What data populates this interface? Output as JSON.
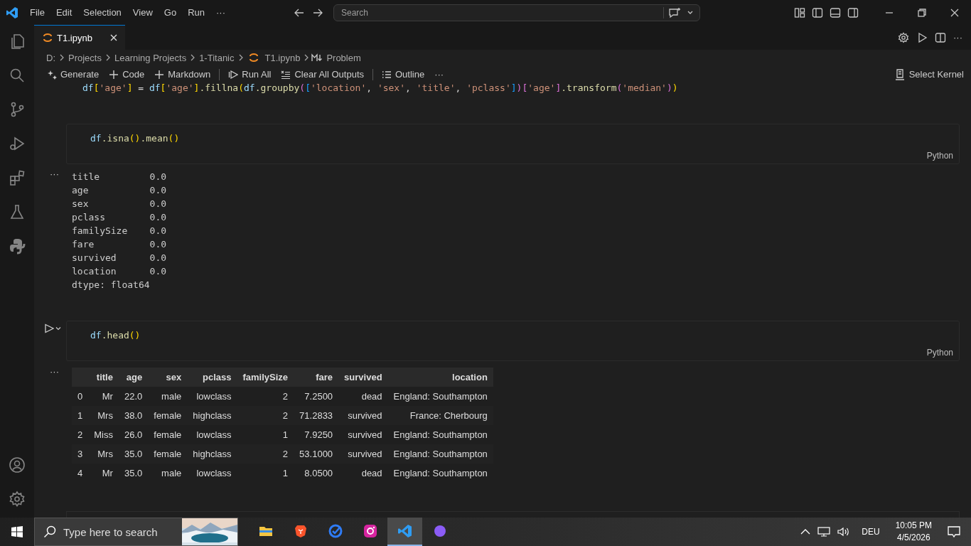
{
  "menu": [
    "File",
    "Edit",
    "Selection",
    "View",
    "Go",
    "Run",
    "···"
  ],
  "search": {
    "placeholder": "Search"
  },
  "tabs": [
    {
      "label": "T1.ipynb",
      "selected": true
    }
  ],
  "editor_actions_more": "···",
  "breadcrumb": [
    "D:",
    "Projects",
    "Learning Projects",
    "1-Titanic",
    "T1.ipynb",
    "Problem"
  ],
  "toolbar": [
    {
      "label": "Generate",
      "kind": "generate"
    },
    {
      "label": "Code",
      "kind": "add"
    },
    {
      "label": "Markdown",
      "kind": "add"
    },
    {
      "label": "Run All",
      "kind": "runall"
    },
    {
      "label": "Clear All Outputs",
      "kind": "clear"
    },
    {
      "label": "Outline",
      "kind": "outline"
    },
    {
      "label": "···",
      "kind": "more"
    }
  ],
  "kernel": "Select Kernel",
  "cells": [
    {
      "kind": "partial",
      "code": [
        {
          "text": "df",
          "kind": "var"
        },
        {
          "text": "[",
          "kind": "br1"
        },
        {
          "text": "'age'",
          "kind": "str"
        },
        {
          "text": "]",
          "kind": "br1"
        },
        {
          "text": " = ",
          "kind": "punc"
        },
        {
          "text": "df",
          "kind": "var"
        },
        {
          "text": "[",
          "kind": "br1"
        },
        {
          "text": "'age'",
          "kind": "str"
        },
        {
          "text": "]",
          "kind": "br1"
        },
        {
          "text": ".fillna",
          "kind": "fn"
        },
        {
          "text": "(",
          "kind": "br1"
        },
        {
          "text": "df",
          "kind": "var"
        },
        {
          "text": ".groupby",
          "kind": "fn"
        },
        {
          "text": "(",
          "kind": "br2"
        },
        {
          "text": "[",
          "kind": "br3"
        },
        {
          "text": "'location'",
          "kind": "str"
        },
        {
          "text": ", ",
          "kind": "punc"
        },
        {
          "text": "'sex'",
          "kind": "str"
        },
        {
          "text": ", ",
          "kind": "punc"
        },
        {
          "text": "'title'",
          "kind": "str"
        },
        {
          "text": ", ",
          "kind": "punc"
        },
        {
          "text": "'pclass'",
          "kind": "str"
        },
        {
          "text": "]",
          "kind": "br3"
        },
        {
          "text": ")",
          "kind": "br2"
        },
        {
          "text": "[",
          "kind": "br2"
        },
        {
          "text": "'age'",
          "kind": "str"
        },
        {
          "text": "]",
          "kind": "br2"
        },
        {
          "text": ".transform",
          "kind": "fn"
        },
        {
          "text": "(",
          "kind": "br2"
        },
        {
          "text": "'median'",
          "kind": "str"
        },
        {
          "text": ")",
          "kind": "br2"
        },
        {
          "text": ")",
          "kind": "br1"
        }
      ]
    },
    {
      "kind": "code",
      "run_button": false,
      "language": "Python",
      "code": [
        {
          "text": "df",
          "kind": "var"
        },
        {
          "text": ".isna",
          "kind": "fn"
        },
        {
          "text": "()",
          "kind": "br1"
        },
        {
          "text": ".mean",
          "kind": "fn"
        },
        {
          "text": "()",
          "kind": "br1"
        }
      ],
      "output_menu": "···",
      "output": {
        "kind": "text",
        "lines": [
          "title         0.0",
          "age           0.0",
          "sex           0.0",
          "pclass        0.0",
          "familySize    0.0",
          "fare          0.0",
          "survived      0.0",
          "location      0.0",
          "dtype: float64"
        ]
      }
    },
    {
      "kind": "code",
      "run_button": true,
      "language": "Python",
      "code": [
        {
          "text": "df",
          "kind": "var"
        },
        {
          "text": ".head",
          "kind": "fn"
        },
        {
          "text": "()",
          "kind": "br1"
        }
      ],
      "output_menu": "···",
      "output": {
        "kind": "table",
        "columns": [
          "title",
          "age",
          "sex",
          "pclass",
          "familySize",
          "fare",
          "survived",
          "location"
        ],
        "rows": [
          {
            "index": "0",
            "cells": [
              "Mr",
              "22.0",
              "male",
              "lowclass",
              "2",
              "7.2500",
              "dead",
              "England: Southampton"
            ]
          },
          {
            "index": "1",
            "cells": [
              "Mrs",
              "38.0",
              "female",
              "highclass",
              "2",
              "71.2833",
              "survived",
              "France: Cherbourg"
            ]
          },
          {
            "index": "2",
            "cells": [
              "Miss",
              "26.0",
              "female",
              "lowclass",
              "1",
              "7.9250",
              "survived",
              "England: Southampton"
            ]
          },
          {
            "index": "3",
            "cells": [
              "Mrs",
              "35.0",
              "female",
              "highclass",
              "2",
              "53.1000",
              "survived",
              "England: Southampton"
            ]
          },
          {
            "index": "4",
            "cells": [
              "Mr",
              "35.0",
              "male",
              "lowclass",
              "1",
              "8.0500",
              "dead",
              "England: Southampton"
            ]
          }
        ]
      }
    },
    {
      "kind": "empty"
    }
  ],
  "taskbar": {
    "search_placeholder": "Type here to search",
    "apps": [
      {
        "kind": "folder",
        "selected": false
      },
      {
        "kind": "lion",
        "selected": false
      },
      {
        "kind": "check",
        "selected": false
      },
      {
        "kind": "camera",
        "selected": false
      },
      {
        "kind": "vscode",
        "selected": true
      },
      {
        "kind": "purple",
        "selected": false
      }
    ],
    "language": "DEU",
    "time": "10:05 PM",
    "date": "4/5/2026"
  }
}
